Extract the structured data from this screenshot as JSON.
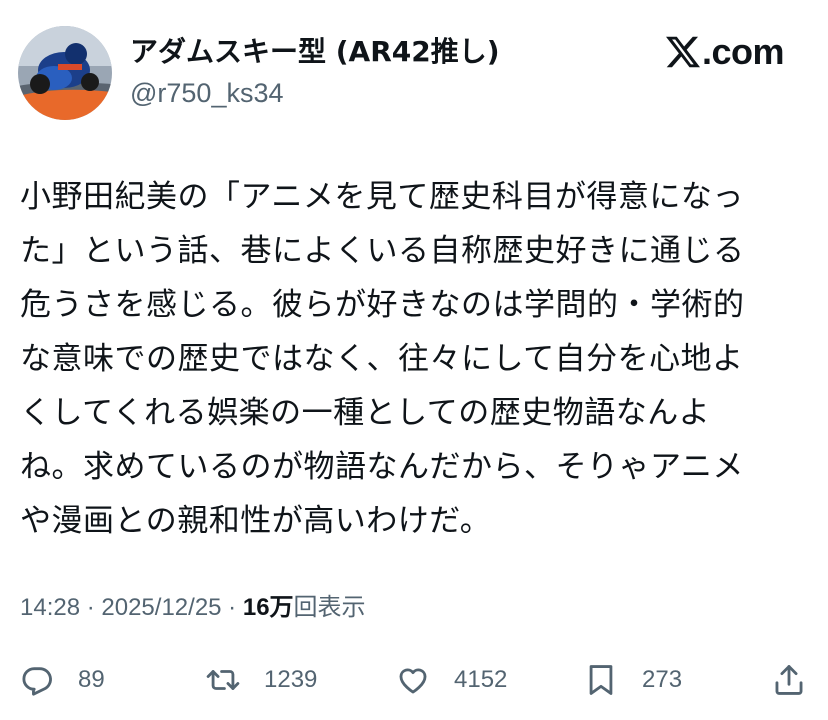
{
  "author": {
    "display_name": "アダムスキー型 (AR42推し)",
    "handle": "@r750_ks34"
  },
  "brand": {
    "text": ".com",
    "icon": "x-logo-icon"
  },
  "post": {
    "lines": [
      "小野田紀美の「アニメを見て歴史科目が得意になっ",
      "た」という話、巷によくいる自称歴史好きに通じる",
      "危うさを感じる。彼らが好きなのは学問的・学術的",
      "な意味での歴史ではなく、往々にして自分を心地よ",
      "くしてくれる娯楽の一種としての歴史物語なんよ",
      "ね。求めているのが物語なんだから、そりゃアニメ",
      "や漫画との親和性が高いわけだ。"
    ]
  },
  "meta": {
    "time": "14:28",
    "sep1": " · ",
    "date": "2025/12/25",
    "sep2": " · ",
    "views_count": "16万",
    "views_label": "回表示"
  },
  "actions": {
    "replies": {
      "count": "89",
      "icon": "reply-icon"
    },
    "reposts": {
      "count": "1239",
      "icon": "repost-icon"
    },
    "likes": {
      "count": "4152",
      "icon": "heart-icon"
    },
    "bookmarks": {
      "count": "273",
      "icon": "bookmark-icon"
    },
    "share": {
      "icon": "share-icon"
    }
  },
  "colors": {
    "text_primary": "#0f1419",
    "text_secondary": "#536471",
    "background": "#ffffff"
  }
}
